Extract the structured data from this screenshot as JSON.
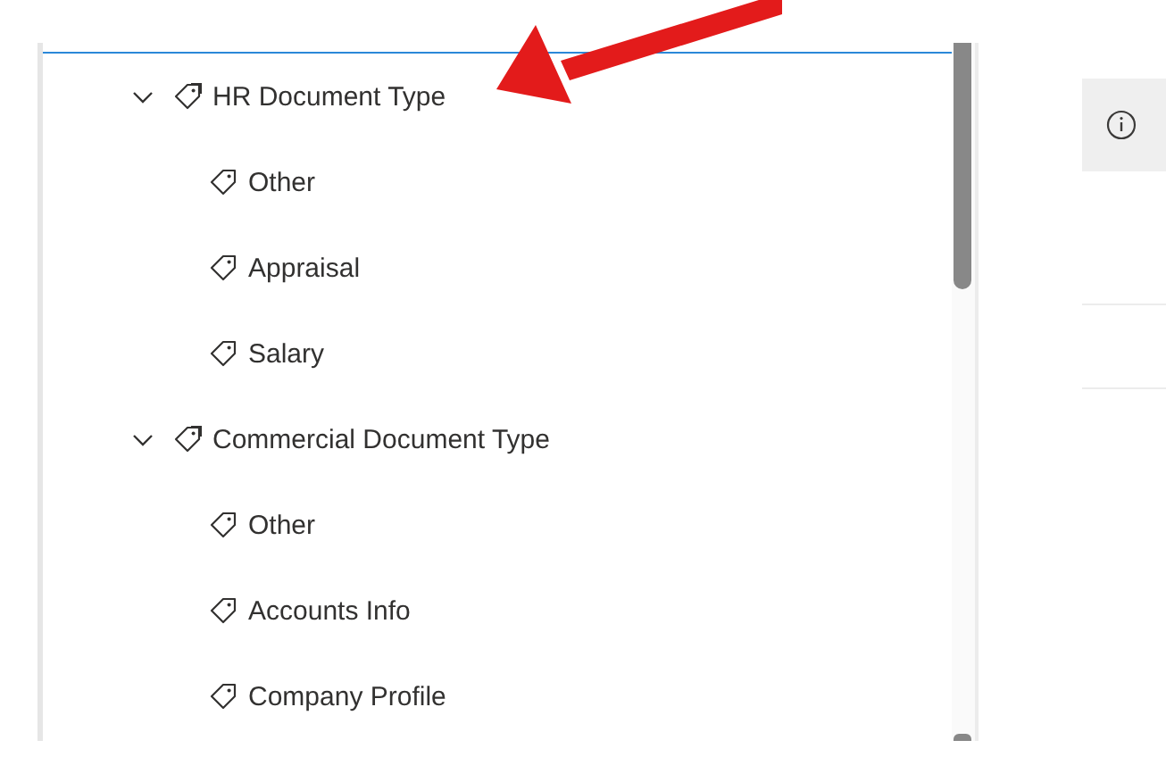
{
  "tree": [
    {
      "label": "HR Document Type",
      "expanded": true,
      "children": [
        {
          "label": "Other"
        },
        {
          "label": "Appraisal"
        },
        {
          "label": "Salary"
        }
      ]
    },
    {
      "label": "Commercial Document Type",
      "expanded": true,
      "children": [
        {
          "label": "Other"
        },
        {
          "label": "Accounts Info"
        },
        {
          "label": "Company Profile"
        }
      ]
    }
  ]
}
